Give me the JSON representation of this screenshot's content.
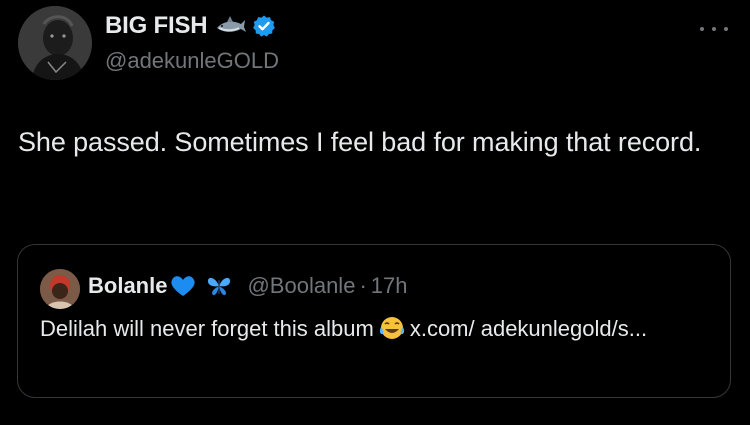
{
  "author": {
    "display_name": "BIG FISH",
    "handle": "@adekunleGOLD",
    "name_icons": [
      "shark-emoji-icon",
      "verified-badge-icon"
    ],
    "avatar": "author-avatar"
  },
  "menu": {
    "more_icon": "more-horizontal-icon"
  },
  "tweet": {
    "text": "She passed. Sometimes I feel bad for making that record."
  },
  "quoted_tweet": {
    "display_name": "Bolanle",
    "name_emojis": [
      "blue-heart-icon",
      "butterfly-icon"
    ],
    "handle": "@Boolanle",
    "separator": "·",
    "time": "17h",
    "text_before_emoji": "Delilah will never forget this album",
    "text_emoji": "face-with-tears-of-joy-icon",
    "link_text": "x.com/ adekunlegold/s..."
  },
  "colors": {
    "background": "#000000",
    "primary_text": "#e7e9ea",
    "secondary_text": "#71767b",
    "border": "#333639",
    "verified": "#1d9bf0"
  }
}
